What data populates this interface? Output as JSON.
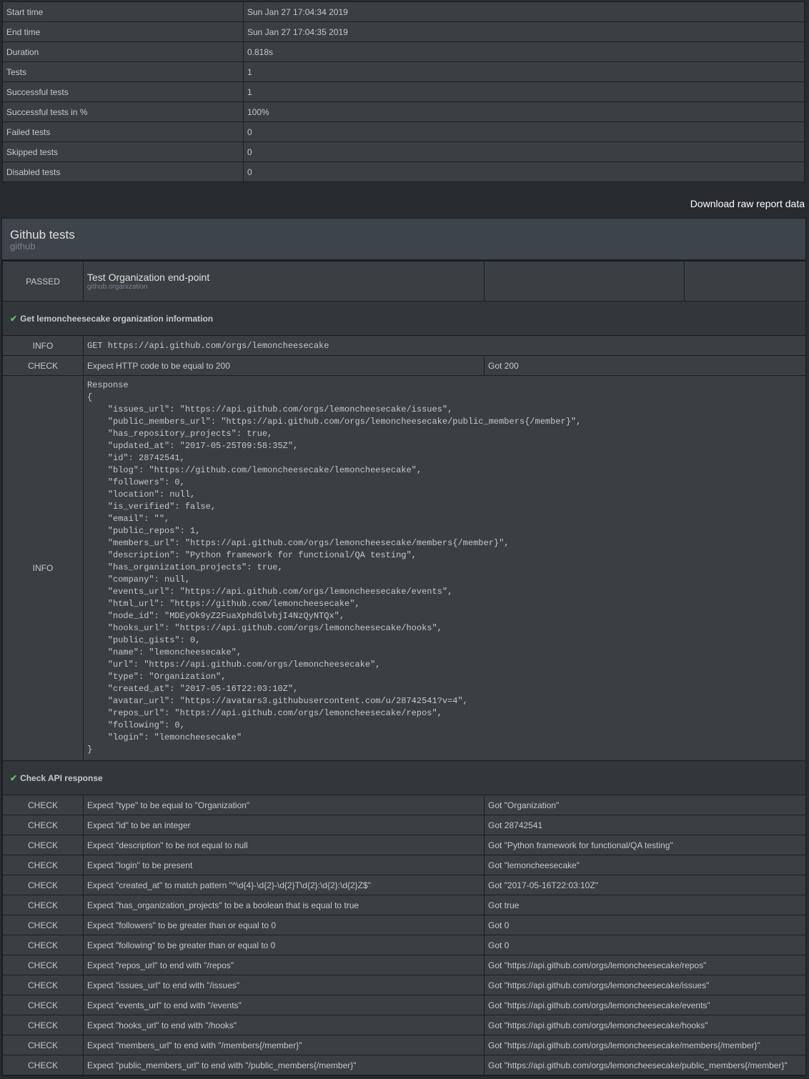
{
  "summary": [
    {
      "label": "Start time",
      "value": "Sun Jan 27 17:04:34 2019"
    },
    {
      "label": "End time",
      "value": "Sun Jan 27 17:04:35 2019"
    },
    {
      "label": "Duration",
      "value": "0.818s"
    },
    {
      "label": "Tests",
      "value": "1"
    },
    {
      "label": "Successful tests",
      "value": "1"
    },
    {
      "label": "Successful tests in %",
      "value": "100%"
    },
    {
      "label": "Failed tests",
      "value": "0"
    },
    {
      "label": "Skipped tests",
      "value": "0"
    },
    {
      "label": "Disabled tests",
      "value": "0"
    }
  ],
  "download_link": "Download raw report data",
  "suite": {
    "title": "Github tests",
    "id": "github"
  },
  "test": {
    "status": "PASSED",
    "title": "Test Organization end-point",
    "id": "github.organization"
  },
  "step1": {
    "title": "Get lemoncheesecake organization information",
    "get_level": "INFO",
    "get_text": "GET https://api.github.com/orgs/lemoncheesecake",
    "check_level": "CHECK",
    "check_text": "Expect HTTP code to be equal to 200",
    "check_result": "Got 200",
    "response_level": "INFO",
    "response_text": "Response\n{\n    \"issues_url\": \"https://api.github.com/orgs/lemoncheesecake/issues\",\n    \"public_members_url\": \"https://api.github.com/orgs/lemoncheesecake/public_members{/member}\",\n    \"has_repository_projects\": true,\n    \"updated_at\": \"2017-05-25T09:58:35Z\",\n    \"id\": 28742541,\n    \"blog\": \"https://github.com/lemoncheesecake/lemoncheesecake\",\n    \"followers\": 0,\n    \"location\": null,\n    \"is_verified\": false,\n    \"email\": \"\",\n    \"public_repos\": 1,\n    \"members_url\": \"https://api.github.com/orgs/lemoncheesecake/members{/member}\",\n    \"description\": \"Python framework for functional/QA testing\",\n    \"has_organization_projects\": true,\n    \"company\": null,\n    \"events_url\": \"https://api.github.com/orgs/lemoncheesecake/events\",\n    \"html_url\": \"https://github.com/lemoncheesecake\",\n    \"node_id\": \"MDEyOk9yZ2FuaXphdGlvbjI4NzQyNTQx\",\n    \"hooks_url\": \"https://api.github.com/orgs/lemoncheesecake/hooks\",\n    \"public_gists\": 0,\n    \"name\": \"lemoncheesecake\",\n    \"url\": \"https://api.github.com/orgs/lemoncheesecake\",\n    \"type\": \"Organization\",\n    \"created_at\": \"2017-05-16T22:03:10Z\",\n    \"avatar_url\": \"https://avatars3.githubusercontent.com/u/28742541?v=4\",\n    \"repos_url\": \"https://api.github.com/orgs/lemoncheesecake/repos\",\n    \"following\": 0,\n    \"login\": \"lemoncheesecake\"\n}"
  },
  "step2": {
    "title": "Check API response",
    "checks": [
      {
        "level": "CHECK",
        "expect": "Expect \"type\" to be equal to \"Organization\"",
        "got": "Got \"Organization\""
      },
      {
        "level": "CHECK",
        "expect": "Expect \"id\" to be an integer",
        "got": "Got 28742541"
      },
      {
        "level": "CHECK",
        "expect": "Expect \"description\" to be not equal to null",
        "got": "Got \"Python framework for functional/QA testing\""
      },
      {
        "level": "CHECK",
        "expect": "Expect \"login\" to be present",
        "got": "Got \"lemoncheesecake\""
      },
      {
        "level": "CHECK",
        "expect": "Expect \"created_at\" to match pattern \"^\\d{4}-\\d{2}-\\d{2}T\\d{2}:\\d{2}:\\d{2}Z$\"",
        "got": "Got \"2017-05-16T22:03:10Z\""
      },
      {
        "level": "CHECK",
        "expect": "Expect \"has_organization_projects\" to be a boolean that is equal to true",
        "got": "Got true"
      },
      {
        "level": "CHECK",
        "expect": "Expect \"followers\" to be greater than or equal to 0",
        "got": "Got 0"
      },
      {
        "level": "CHECK",
        "expect": "Expect \"following\" to be greater than or equal to 0",
        "got": "Got 0"
      },
      {
        "level": "CHECK",
        "expect": "Expect \"repos_url\" to end with \"/repos\"",
        "got": "Got \"https://api.github.com/orgs/lemoncheesecake/repos\""
      },
      {
        "level": "CHECK",
        "expect": "Expect \"issues_url\" to end with \"/issues\"",
        "got": "Got \"https://api.github.com/orgs/lemoncheesecake/issues\""
      },
      {
        "level": "CHECK",
        "expect": "Expect \"events_url\" to end with \"/events\"",
        "got": "Got \"https://api.github.com/orgs/lemoncheesecake/events\""
      },
      {
        "level": "CHECK",
        "expect": "Expect \"hooks_url\" to end with \"/hooks\"",
        "got": "Got \"https://api.github.com/orgs/lemoncheesecake/hooks\""
      },
      {
        "level": "CHECK",
        "expect": "Expect \"members_url\" to end with \"/members{/member}\"",
        "got": "Got \"https://api.github.com/orgs/lemoncheesecake/members{/member}\""
      },
      {
        "level": "CHECK",
        "expect": "Expect \"public_members_url\" to end with \"/public_members{/member}\"",
        "got": "Got \"https://api.github.com/orgs/lemoncheesecake/public_members{/member}\""
      }
    ]
  },
  "colors": {
    "background": "#272b30",
    "panel": "#3a3f44",
    "passed": "#62c462",
    "info": "#5bc0de"
  }
}
